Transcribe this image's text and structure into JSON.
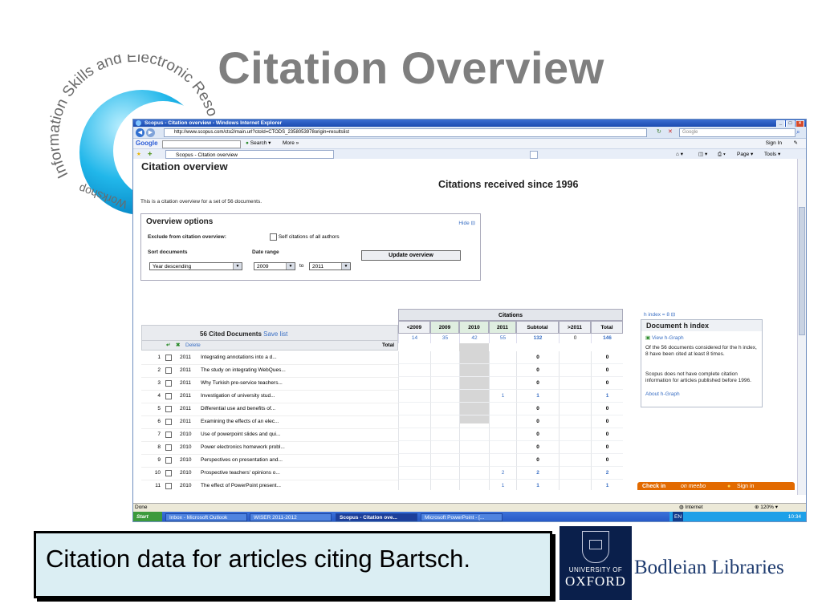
{
  "slide": {
    "title": "Citation Overview",
    "caption": "Citation data for articles citing Bartsch.",
    "logo_text": "Information Skills and Electronic Resources Workshop",
    "oxford_line1": "UNIVERSITY OF",
    "oxford_line2": "OXFORD",
    "bodleian": "Bodleian Libraries"
  },
  "browser": {
    "title": "Scopus - Citation overview - Windows Internet Explorer",
    "url": "http://www.scopus.com/cto2/main.url?ctoId=CTODS_2358053978origin=resultslist",
    "search_placeholder": "Google",
    "google_label": "Google",
    "search_btn": "Search",
    "more": "More »",
    "sign_in": "Sign In",
    "tab_title": "Scopus - Citation overview",
    "page_menu": "Page",
    "tools_menu": "Tools",
    "status": "Done",
    "zone": "Internet",
    "zoom": "120%"
  },
  "taskbar": {
    "start": "Start",
    "items": [
      "Inbox - Microsoft Outlook",
      "WISER 2011-2012",
      "Scopus - Citation ove...",
      "Microsoft PowerPoint - [..."
    ],
    "lang": "EN",
    "clock": "10:34"
  },
  "page": {
    "heading": "Citation overview",
    "since": "Citations received since 1996",
    "intro": "This is a citation overview for a set of 56 documents.",
    "options": {
      "title": "Overview options",
      "hide": "Hide",
      "exclude_label": "Exclude from citation overview:",
      "self_citations": "Self citations of all authors",
      "sort_label": "Sort documents",
      "sort_value": "Year descending",
      "date_label": "Date range",
      "date_from": "2009",
      "to": "to",
      "date_to": "2011",
      "update": "Update overview"
    },
    "docs": {
      "title": "56 Cited Documents",
      "save": "Save list",
      "delete": "Delete",
      "total": "Total",
      "rows": [
        {
          "n": "1",
          "year": "2011",
          "title": "Integrating annotations into a d..."
        },
        {
          "n": "2",
          "year": "2011",
          "title": "The study on integrating WebQues..."
        },
        {
          "n": "3",
          "year": "2011",
          "title": "Why Turkish pre-service teachers..."
        },
        {
          "n": "4",
          "year": "2011",
          "title": "Investigation of university stud..."
        },
        {
          "n": "5",
          "year": "2011",
          "title": "Differential use and benefits of..."
        },
        {
          "n": "6",
          "year": "2011",
          "title": "Examining the effects of an elec..."
        },
        {
          "n": "7",
          "year": "2010",
          "title": "Use of powerpoint slides and qui..."
        },
        {
          "n": "8",
          "year": "2010",
          "title": "Power electronics homework probl..."
        },
        {
          "n": "9",
          "year": "2010",
          "title": "Perspectives on presentation and..."
        },
        {
          "n": "10",
          "year": "2010",
          "title": "Prospective teachers' opinions o..."
        },
        {
          "n": "11",
          "year": "2010",
          "title": "The effect of PowerPoint present..."
        }
      ]
    },
    "citations": {
      "title": "Citations",
      "columns": [
        "<2009",
        "2009",
        "2010",
        "2011",
        "Subtotal",
        ">2011",
        "Total"
      ],
      "totals": [
        "14",
        "35",
        "42",
        "55",
        "132",
        "0",
        "146"
      ],
      "rows": [
        [
          "",
          "",
          "",
          "",
          "0",
          "",
          "0"
        ],
        [
          "",
          "",
          "",
          "",
          "0",
          "",
          "0"
        ],
        [
          "",
          "",
          "",
          "",
          "0",
          "",
          "0"
        ],
        [
          "",
          "",
          "",
          "1",
          "1",
          "",
          "1"
        ],
        [
          "",
          "",
          "",
          "",
          "0",
          "",
          "0"
        ],
        [
          "",
          "",
          "",
          "",
          "0",
          "",
          "0"
        ],
        [
          "",
          "",
          "",
          "",
          "0",
          "",
          "0"
        ],
        [
          "",
          "",
          "",
          "",
          "0",
          "",
          "0"
        ],
        [
          "",
          "",
          "",
          "",
          "0",
          "",
          "0"
        ],
        [
          "",
          "",
          "",
          "2",
          "2",
          "",
          "2"
        ],
        [
          "",
          "",
          "",
          "1",
          "1",
          "",
          "1"
        ]
      ]
    },
    "hindex": {
      "label": "h index = 8",
      "title": "Document h index",
      "view_graph": "View h-Graph",
      "text1": "Of the 56 documents considered for the h index, 8 have been cited at least 8 times.",
      "text2": "Scopus does not have complete citation information for articles published before 1996.",
      "about": "About h-Graph"
    },
    "meebo": {
      "check_in": "Check in",
      "brand": "on meebo",
      "sign_in": "Sign in"
    }
  }
}
